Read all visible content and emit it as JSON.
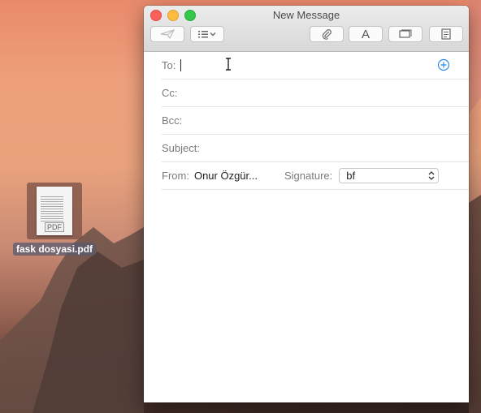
{
  "desktop": {
    "file_name": "fask dosyasi.pdf",
    "file_badge": "PDF"
  },
  "window": {
    "title": "New Message"
  },
  "toolbar": {
    "send_icon": "paper-plane-icon",
    "header_fields_icon": "list-chevron-icon",
    "attach_icon": "paperclip-icon",
    "format_label": "A",
    "browser_icon": "photo-browser-icon",
    "stationery_icon": "stationery-icon"
  },
  "compose": {
    "to_label": "To:",
    "cc_label": "Cc:",
    "bcc_label": "Bcc:",
    "subject_label": "Subject:",
    "from_label": "From:",
    "from_value": "Onur Özgür...",
    "signature_label": "Signature:",
    "signature_value": "bf",
    "add_icon": "plus-circle-icon"
  },
  "colors": {
    "accent": "#2a8ce8",
    "close": "#fc605b",
    "minimize": "#fdbc40",
    "maximize": "#34c84a"
  }
}
